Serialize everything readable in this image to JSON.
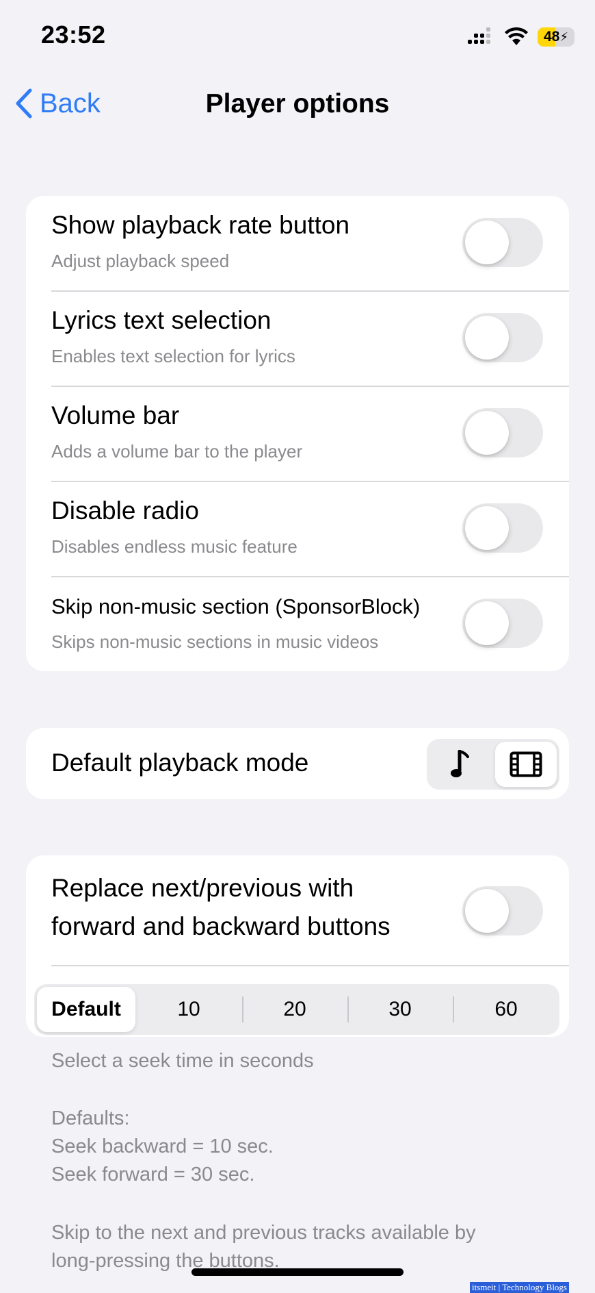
{
  "status_bar": {
    "time": "23:52",
    "battery": "48"
  },
  "nav": {
    "back_label": "Back",
    "title": "Player options"
  },
  "toggles": [
    {
      "title": "Show playback rate button",
      "subtitle": "Adjust playback speed",
      "on": false
    },
    {
      "title": "Lyrics text selection",
      "subtitle": "Enables text selection for lyrics",
      "on": false
    },
    {
      "title": "Volume bar",
      "subtitle": "Adds a volume bar to the player",
      "on": false
    },
    {
      "title": "Disable radio",
      "subtitle": "Disables endless music feature",
      "on": false
    },
    {
      "title": "Skip non-music section (SponsorBlock)",
      "subtitle": "Skips non-music sections in music videos",
      "on": false
    }
  ],
  "playback_mode": {
    "label": "Default playback mode",
    "options": [
      "music-note-icon",
      "film-icon"
    ],
    "selected": "film-icon"
  },
  "replace_buttons": {
    "title_line1": "Replace next/previous with",
    "title_line2": "forward and backward buttons",
    "on": false
  },
  "seek": {
    "options": [
      "Default",
      "10",
      "20",
      "30",
      "60"
    ],
    "selected": "Default"
  },
  "footer": {
    "line1": "Select a seek time in seconds",
    "defaults_heading": "Defaults:",
    "defaults_backward": "Seek backward = 10 sec.",
    "defaults_forward": "Seek forward = 30 sec.",
    "skip_line1": "Skip to the next and previous tracks available by",
    "skip_line2": "long-pressing the buttons."
  },
  "watermark": "itsmeit | Technology Blogs",
  "colors": {
    "accent": "#2f7cf6",
    "background": "#f2f2f7",
    "battery": "#ffd60a"
  }
}
